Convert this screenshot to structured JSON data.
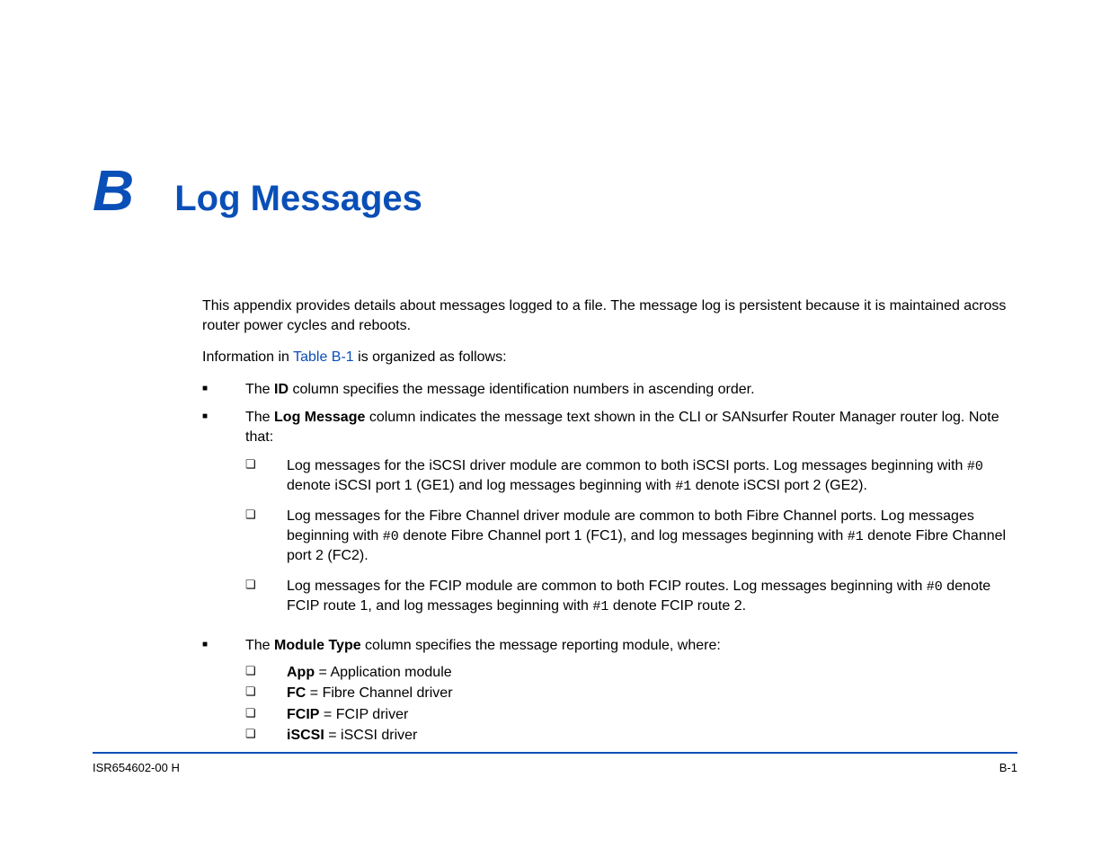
{
  "heading": {
    "letter": "B",
    "title": "Log Messages"
  },
  "body": {
    "p1": "This appendix provides details about messages logged to a file. The message log is persistent because it is maintained across router power cycles and reboots.",
    "p2_pre": "Information in ",
    "p2_link": "Table B-1",
    "p2_post": " is organized as follows:",
    "b1_pre": "The ",
    "b1_bold": "ID",
    "b1_post": " column specifies the message identification numbers in ascending order.",
    "b2_pre": "The ",
    "b2_bold": "Log Message",
    "b2_post": " column indicates the message text shown in the CLI or SANsurfer Router Manager router log. Note that:",
    "b2_s1_a": "Log messages for the iSCSI driver module are common to both iSCSI ports. Log messages beginning with ",
    "b2_s1_code1": "#0",
    "b2_s1_b": " denote iSCSI port 1 (GE1) and log messages beginning with ",
    "b2_s1_code2": "#1",
    "b2_s1_c": " denote iSCSI port 2 (GE2).",
    "b2_s2_a": "Log messages for the Fibre Channel driver module are common to both Fibre Channel ports. Log messages beginning with ",
    "b2_s2_code1": "#0",
    "b2_s2_b": " denote Fibre Channel port 1 (FC1), and log messages beginning with ",
    "b2_s2_code2": "#1",
    "b2_s2_c": " denote Fibre Channel port 2 (FC2).",
    "b2_s3_a": "Log messages for the FCIP module are common to both FCIP routes. Log messages beginning with ",
    "b2_s3_code1": "#0",
    "b2_s3_b": " denote FCIP route 1, and log messages beginning with ",
    "b2_s3_code2": "#1",
    "b2_s3_c": " denote FCIP route 2.",
    "b3_pre": "The ",
    "b3_bold": "Module Type",
    "b3_post": " column specifies the message reporting module, where:",
    "b3_s1_bold": "App",
    "b3_s1_rest": " = Application module",
    "b3_s2_bold": "FC",
    "b3_s2_rest": " = Fibre Channel driver",
    "b3_s3_bold": "FCIP",
    "b3_s3_rest": " = FCIP driver",
    "b3_s4_bold": "iSCSI",
    "b3_s4_rest": " = iSCSI driver"
  },
  "footer": {
    "doc_id": "ISR654602-00  H",
    "page_num": "B-1"
  }
}
